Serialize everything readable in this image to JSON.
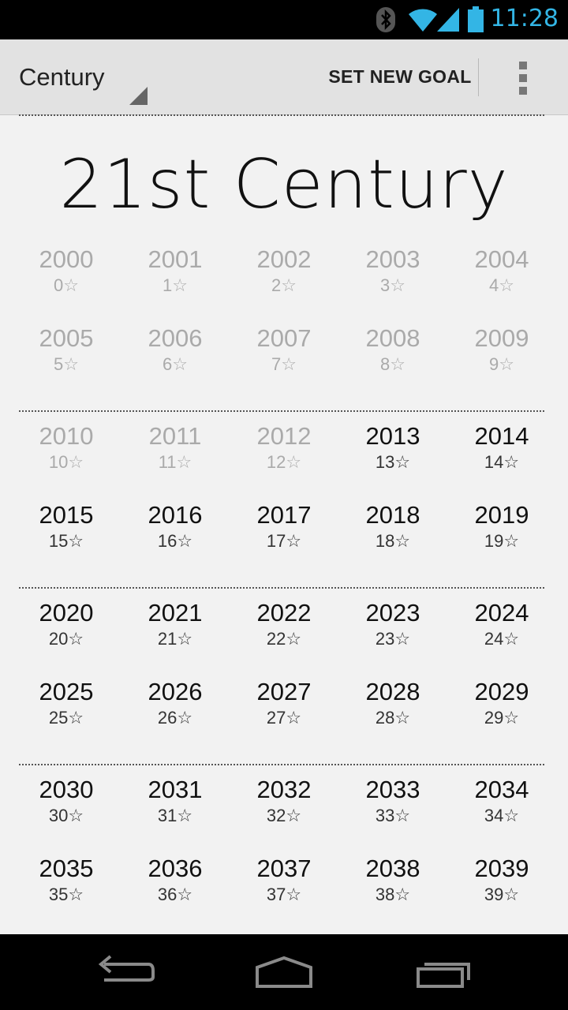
{
  "status": {
    "time": "11:28"
  },
  "action_bar": {
    "spinner_label": "Century",
    "set_goal_label": "SET NEW GOAL"
  },
  "century_title": "21st Century",
  "star_glyph": "☆",
  "decades": [
    [
      {
        "year": "2000",
        "stars": "0"
      },
      {
        "year": "2001",
        "stars": "1"
      },
      {
        "year": "2002",
        "stars": "2"
      },
      {
        "year": "2003",
        "stars": "3"
      },
      {
        "year": "2004",
        "stars": "4"
      },
      {
        "year": "2005",
        "stars": "5"
      },
      {
        "year": "2006",
        "stars": "6"
      },
      {
        "year": "2007",
        "stars": "7"
      },
      {
        "year": "2008",
        "stars": "8"
      },
      {
        "year": "2009",
        "stars": "9"
      }
    ],
    [
      {
        "year": "2010",
        "stars": "10"
      },
      {
        "year": "2011",
        "stars": "11"
      },
      {
        "year": "2012",
        "stars": "12"
      },
      {
        "year": "2013",
        "stars": "13"
      },
      {
        "year": "2014",
        "stars": "14"
      },
      {
        "year": "2015",
        "stars": "15"
      },
      {
        "year": "2016",
        "stars": "16"
      },
      {
        "year": "2017",
        "stars": "17"
      },
      {
        "year": "2018",
        "stars": "18"
      },
      {
        "year": "2019",
        "stars": "19"
      }
    ],
    [
      {
        "year": "2020",
        "stars": "20"
      },
      {
        "year": "2021",
        "stars": "21"
      },
      {
        "year": "2022",
        "stars": "22"
      },
      {
        "year": "2023",
        "stars": "23"
      },
      {
        "year": "2024",
        "stars": "24"
      },
      {
        "year": "2025",
        "stars": "25"
      },
      {
        "year": "2026",
        "stars": "26"
      },
      {
        "year": "2027",
        "stars": "27"
      },
      {
        "year": "2028",
        "stars": "28"
      },
      {
        "year": "2029",
        "stars": "29"
      }
    ],
    [
      {
        "year": "2030",
        "stars": "30"
      },
      {
        "year": "2031",
        "stars": "31"
      },
      {
        "year": "2032",
        "stars": "32"
      },
      {
        "year": "2033",
        "stars": "33"
      },
      {
        "year": "2034",
        "stars": "34"
      },
      {
        "year": "2035",
        "stars": "35"
      },
      {
        "year": "2036",
        "stars": "36"
      },
      {
        "year": "2037",
        "stars": "37"
      },
      {
        "year": "2038",
        "stars": "38"
      },
      {
        "year": "2039",
        "stars": "39"
      }
    ]
  ],
  "past_through_year": "2012",
  "icons": {
    "status": [
      "bluetooth-icon",
      "wifi-icon",
      "signal-icon",
      "battery-icon"
    ],
    "nav": [
      "back-icon",
      "home-icon",
      "recent-apps-icon"
    ]
  },
  "colors": {
    "status_accent": "#33b5e5",
    "past_year": "#aaaaaa",
    "current_year": "#111111"
  }
}
